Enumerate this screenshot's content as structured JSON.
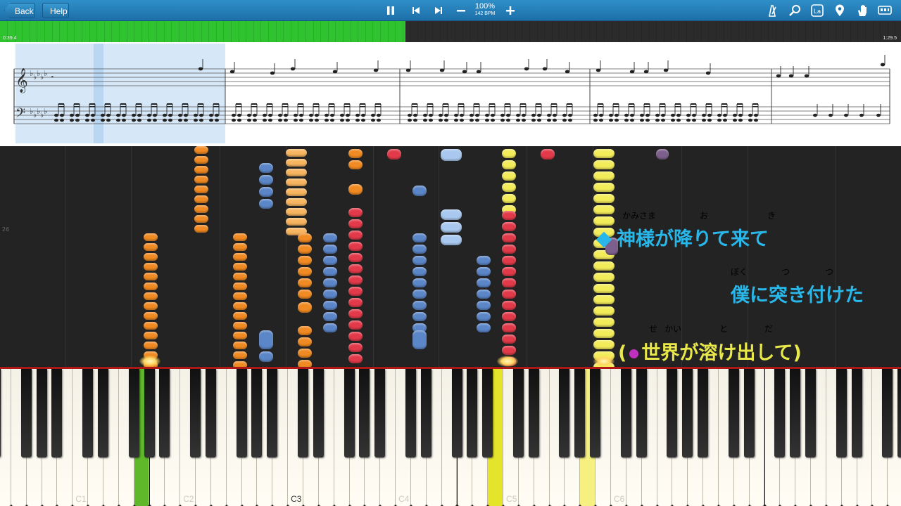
{
  "toolbar": {
    "back_label": "Back",
    "help_label": "Help",
    "tempo_percent": "100%",
    "tempo_bpm": "142 BPM",
    "icons": [
      "pause-icon",
      "skip-back-icon",
      "skip-forward-icon",
      "minus-icon",
      "plus-icon",
      "metronome-icon",
      "zoom-icon",
      "notation-icon",
      "marker-icon",
      "hand-icon",
      "keyboard-icon"
    ]
  },
  "progress": {
    "elapsed": "0:39.4",
    "total": "1:29.5",
    "fraction": 0.45,
    "fill_color": "#2fc42f"
  },
  "roll": {
    "measure_number": "26"
  },
  "lyrics": {
    "line1": "神様が降りて来て",
    "line1_ruby": [
      "かみさま",
      "お",
      "き"
    ],
    "line1_color": "#29b6e8",
    "line2": "僕に突き付けた",
    "line2_ruby": [
      "ぼく",
      "つ",
      "つ"
    ],
    "line2_color": "#29b6e8",
    "line3_open": "(",
    "line3": "世界が溶け出して",
    "line3_close": ")",
    "line3_ruby": [
      "せ",
      "かい",
      "と",
      "だ"
    ],
    "line3_color": "#e8e84a",
    "bullet_color": "#c030c0"
  },
  "keyboard": {
    "labels": [
      "C1",
      "C2",
      "C3",
      "C4",
      "C5",
      "C6"
    ],
    "pressed_colors": {
      "green": "#5fb82a",
      "yellow": "#e4e42a",
      "brightyellow": "#f5f080"
    }
  }
}
